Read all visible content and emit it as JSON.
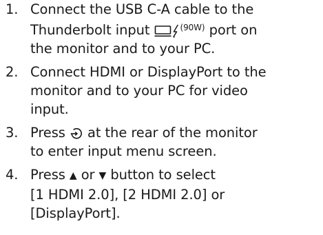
{
  "steps": [
    {
      "number": "1.",
      "text_before": "Connect the USB C-A cable to the\nThunderbolt input ",
      "superscript": "(90W)",
      "text_after": " port on\nthe monitor and to your PC."
    },
    {
      "number": "2.",
      "text": "Connect HDMI or DisplayPort to the\nmonitor and to your PC for video\ninput."
    },
    {
      "number": "3.",
      "text_before": "Press ",
      "text_after": " at the rear of the monitor\nto enter input menu screen."
    },
    {
      "number": "4.",
      "text_before": "Press ",
      "up_glyph": "▲",
      "text_or": " or ",
      "down_glyph": "▼",
      "text_after": " button to select\n[1 HDMI 2.0], [2 HDMI 2.0] or\n[DisplayPort]."
    }
  ],
  "icons": {
    "thunderbolt_port": "monitor-port-icon",
    "power_delivery": "lightning-bolt-icon",
    "input_button": "input-button-icon"
  }
}
